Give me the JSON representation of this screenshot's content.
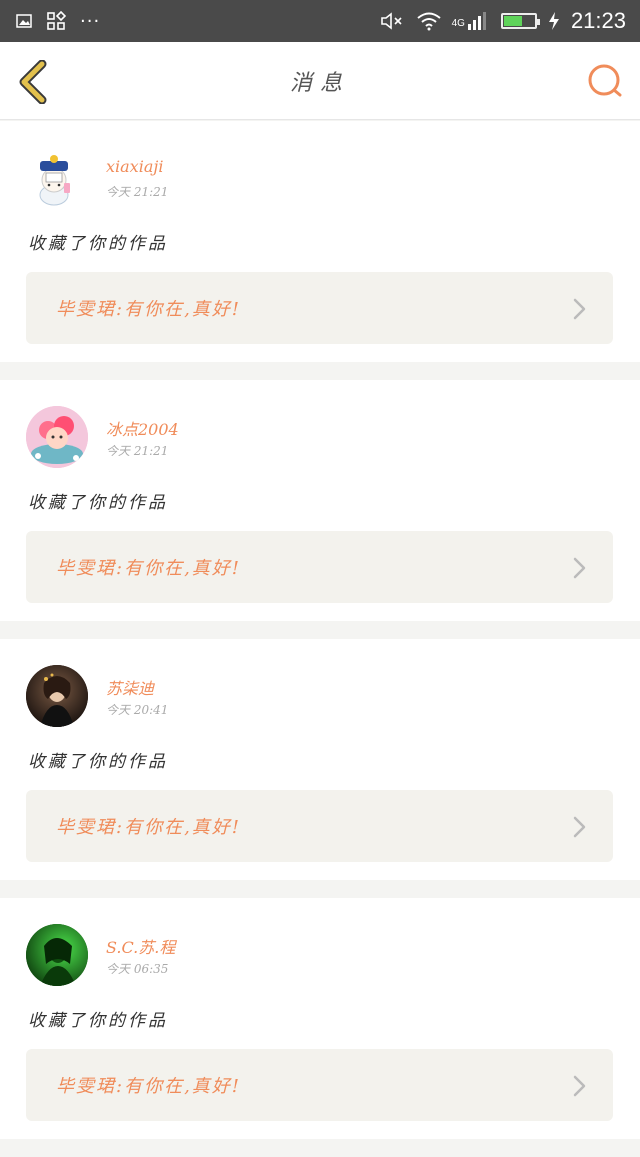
{
  "status_bar": {
    "time": "21:23",
    "network": "4G",
    "more_glyph": "···",
    "icons": [
      "image-icon",
      "apps-icon",
      "more-icon",
      "mute-icon",
      "wifi-icon",
      "signal-icon",
      "battery-icon",
      "charging-icon"
    ]
  },
  "header": {
    "title": "消息",
    "back_icon": "chevron-left-icon",
    "search_icon": "search-icon"
  },
  "colors": {
    "accent": "#f08c5a",
    "back_icon": "#e3c14d",
    "card_inner_bg": "#f3f2ed"
  },
  "messages": [
    {
      "username": "xiaxiaji",
      "time": "今天  21:21",
      "action": "收藏了你的作品",
      "work_title": "毕雯珺:有你在,真好!",
      "avatar": "cartoon-character"
    },
    {
      "username": "冰点2004",
      "time": "今天  21:21",
      "action": "收藏了你的作品",
      "work_title": "毕雯珺:有你在,真好!",
      "avatar": "pink-cartoon"
    },
    {
      "username": "苏柒迪",
      "time": "今天  20:41",
      "action": "收藏了你的作品",
      "work_title": "毕雯珺:有你在,真好!",
      "avatar": "photo-portrait"
    },
    {
      "username": "S.C.苏.程",
      "time": "今天  06:35",
      "action": "收藏了你的作品",
      "work_title": "毕雯珺:有你在,真好!",
      "avatar": "green-portrait"
    }
  ]
}
